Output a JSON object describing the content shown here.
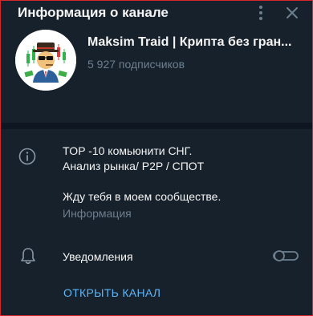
{
  "header": {
    "title": "Информация о канале",
    "menu_icon": "more-vertical-icon",
    "close_icon": "close-icon"
  },
  "channel": {
    "name": "Maksim Traid | Крипта без гран...",
    "subscribers": "5 927 подписчиков",
    "avatar_icon": "trader-cartoon-avatar"
  },
  "description": {
    "line1": "TOP -10 комьюнити СНГ.",
    "line2": "Анализ рынка/ P2P / СПОТ",
    "line3": "Жду тебя в моем сообществе.",
    "label": "Информация"
  },
  "notifications": {
    "label": "Уведомления",
    "enabled": false
  },
  "actions": {
    "open_channel": "ОТКРЫТЬ КАНАЛ"
  },
  "colors": {
    "background": "#17212b",
    "divider": "#0e1621",
    "secondary_text": "#6d7f8f",
    "accent": "#5eb5f7"
  }
}
